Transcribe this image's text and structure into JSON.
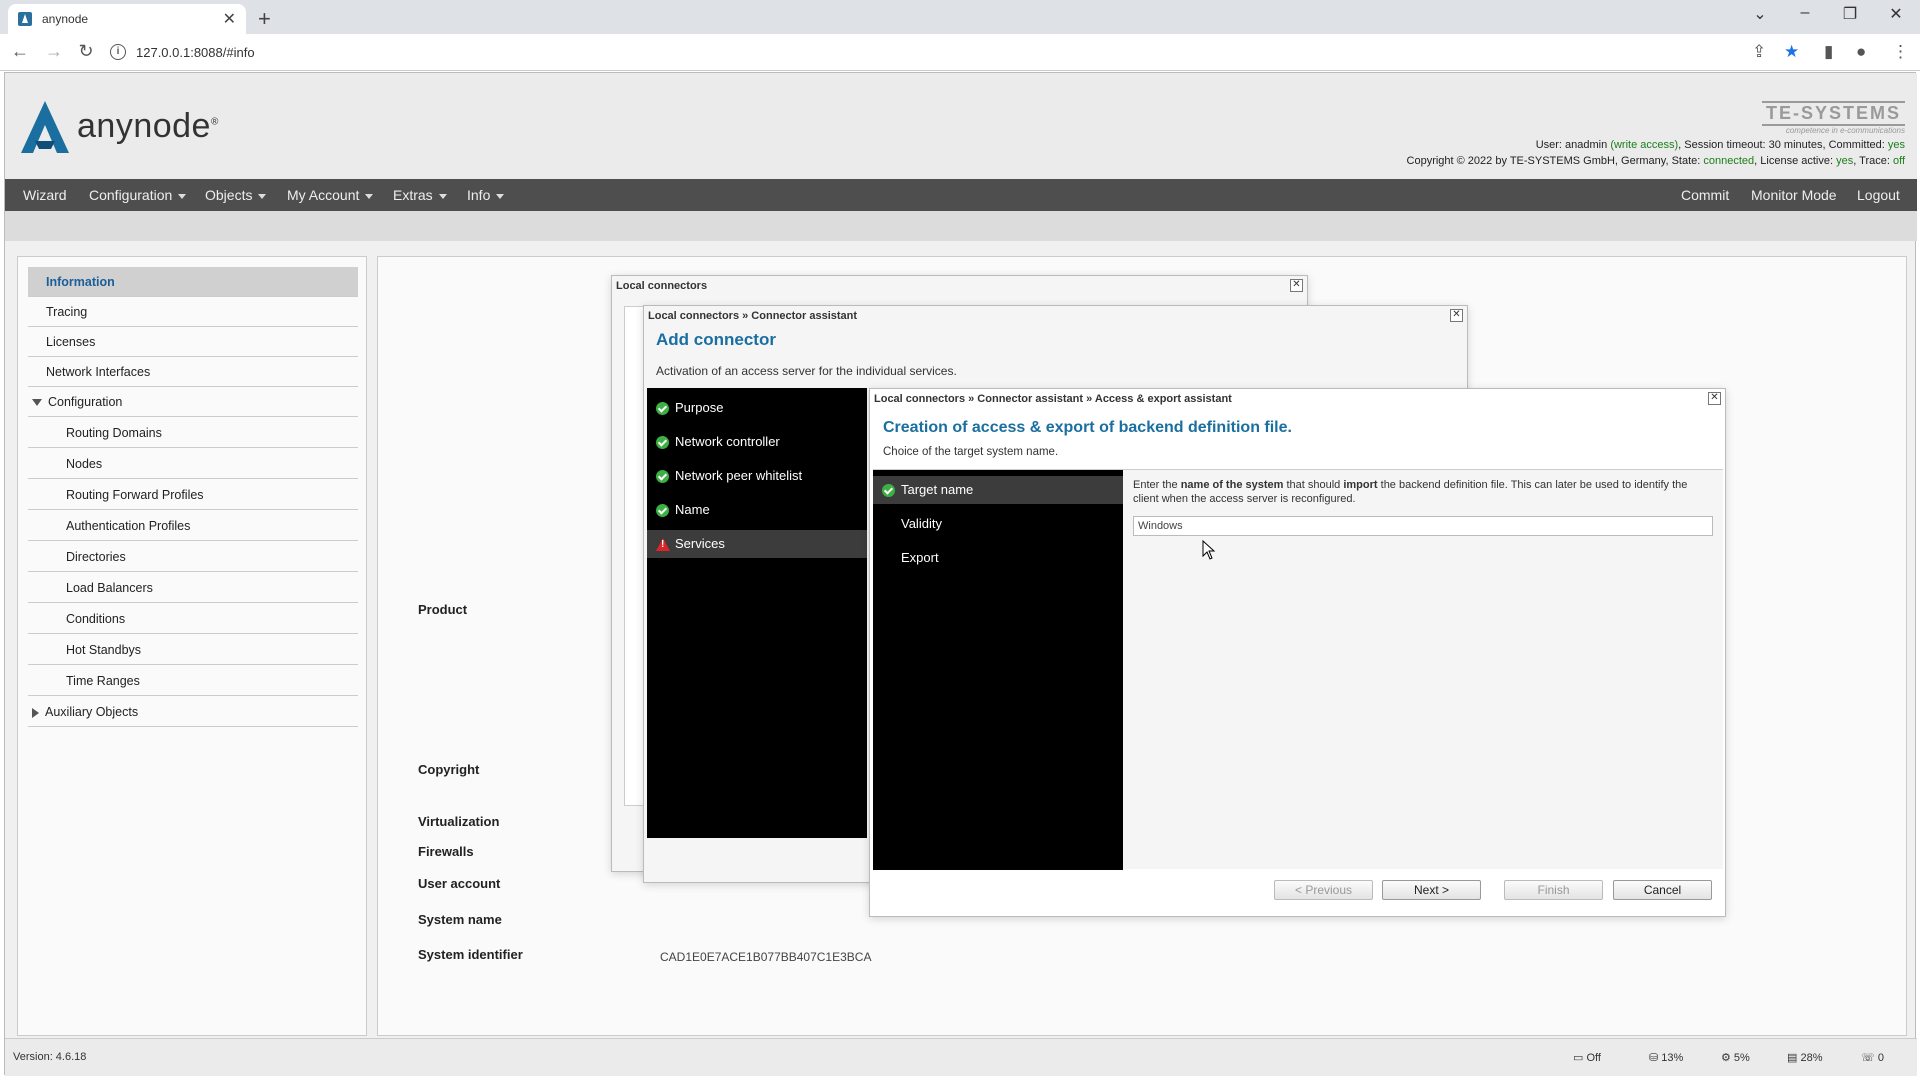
{
  "browser": {
    "tab_title": "anynode",
    "tab_close": "✕",
    "new_tab": "+",
    "url": "127.0.0.1:8088/#info"
  },
  "header": {
    "logo_text": "anynode",
    "logo_reg": "®",
    "vendor_logo": "TE-SYSTEMS",
    "vendor_tagline": "competence in e-communications",
    "status_user": "User: anadmin",
    "status_access": "(write access)",
    "status_session": ", Session timeout: 30 minutes, Committed:",
    "status_committed": "yes",
    "copyright_line": "Copyright © 2022 by TE-SYSTEMS GmbH, Germany, State:",
    "state_value": "connected",
    "license_label": ", License active:",
    "license_value": "yes",
    "trace_label": ", Trace:",
    "trace_value": "off",
    "accent": "#1a5e9a"
  },
  "menu": {
    "wizard": "Wizard",
    "configuration": "Configuration",
    "objects": "Objects",
    "my_account": "My Account",
    "extras": "Extras",
    "info": "Info",
    "commit": "Commit",
    "monitor_mode": "Monitor Mode",
    "logout": "Logout"
  },
  "sidebar": {
    "items": [
      {
        "label": "Information"
      },
      {
        "label": "Tracing"
      },
      {
        "label": "Licenses"
      },
      {
        "label": "Network Interfaces"
      },
      {
        "label": "Configuration"
      },
      {
        "label": "Routing Domains"
      },
      {
        "label": "Nodes"
      },
      {
        "label": "Routing Forward Profiles"
      },
      {
        "label": "Authentication Profiles"
      },
      {
        "label": "Directories"
      },
      {
        "label": "Load Balancers"
      },
      {
        "label": "Conditions"
      },
      {
        "label": "Hot Standbys"
      },
      {
        "label": "Time Ranges"
      },
      {
        "label": "Auxiliary Objects"
      }
    ]
  },
  "info": {
    "product": "Product",
    "copyright": "Copyright",
    "virtualization": "Virtualization",
    "firewalls": "Firewalls",
    "user_account": "User account",
    "system_name": "System name",
    "system_identifier": "System identifier",
    "system_identifier_value": "CAD1E0E7ACE1B077BB407C1E3BCA"
  },
  "dialog_local": {
    "title": "Local connectors",
    "close": "✕"
  },
  "dialog_assistant": {
    "title": "Local connectors » Connector assistant",
    "close": "✕",
    "heading": "Add connector",
    "subheading": "Activation of an access server for the individual services.",
    "steps": [
      {
        "label": "Purpose"
      },
      {
        "label": "Network controller"
      },
      {
        "label": "Network peer whitelist"
      },
      {
        "label": "Name"
      },
      {
        "label": "Services"
      }
    ]
  },
  "dialog_export": {
    "title": "Local connectors » Connector assistant » Access & export assistant",
    "close": "✕",
    "heading": "Creation of access & export of backend definition file.",
    "subheading": "Choice of the target system name.",
    "steps": [
      {
        "label": "Target name"
      },
      {
        "label": "Validity"
      },
      {
        "label": "Export"
      }
    ],
    "desc_1": "Enter the ",
    "desc_bold_1": "name of the system",
    "desc_2": " that should ",
    "desc_bold_2": "import",
    "desc_3": " the backend definition file. This can later be used to identify the client when the access server is reconfigured.",
    "input_value": "Windows",
    "buttons": {
      "previous": "< Previous",
      "next": "Next >",
      "finish": "Finish",
      "cancel": "Cancel"
    }
  },
  "footer": {
    "version": "Version: 4.6.18",
    "stat_1": "Off",
    "stat_2": "13%",
    "stat_3": "5%",
    "stat_4": "28%",
    "stat_5": "0"
  }
}
